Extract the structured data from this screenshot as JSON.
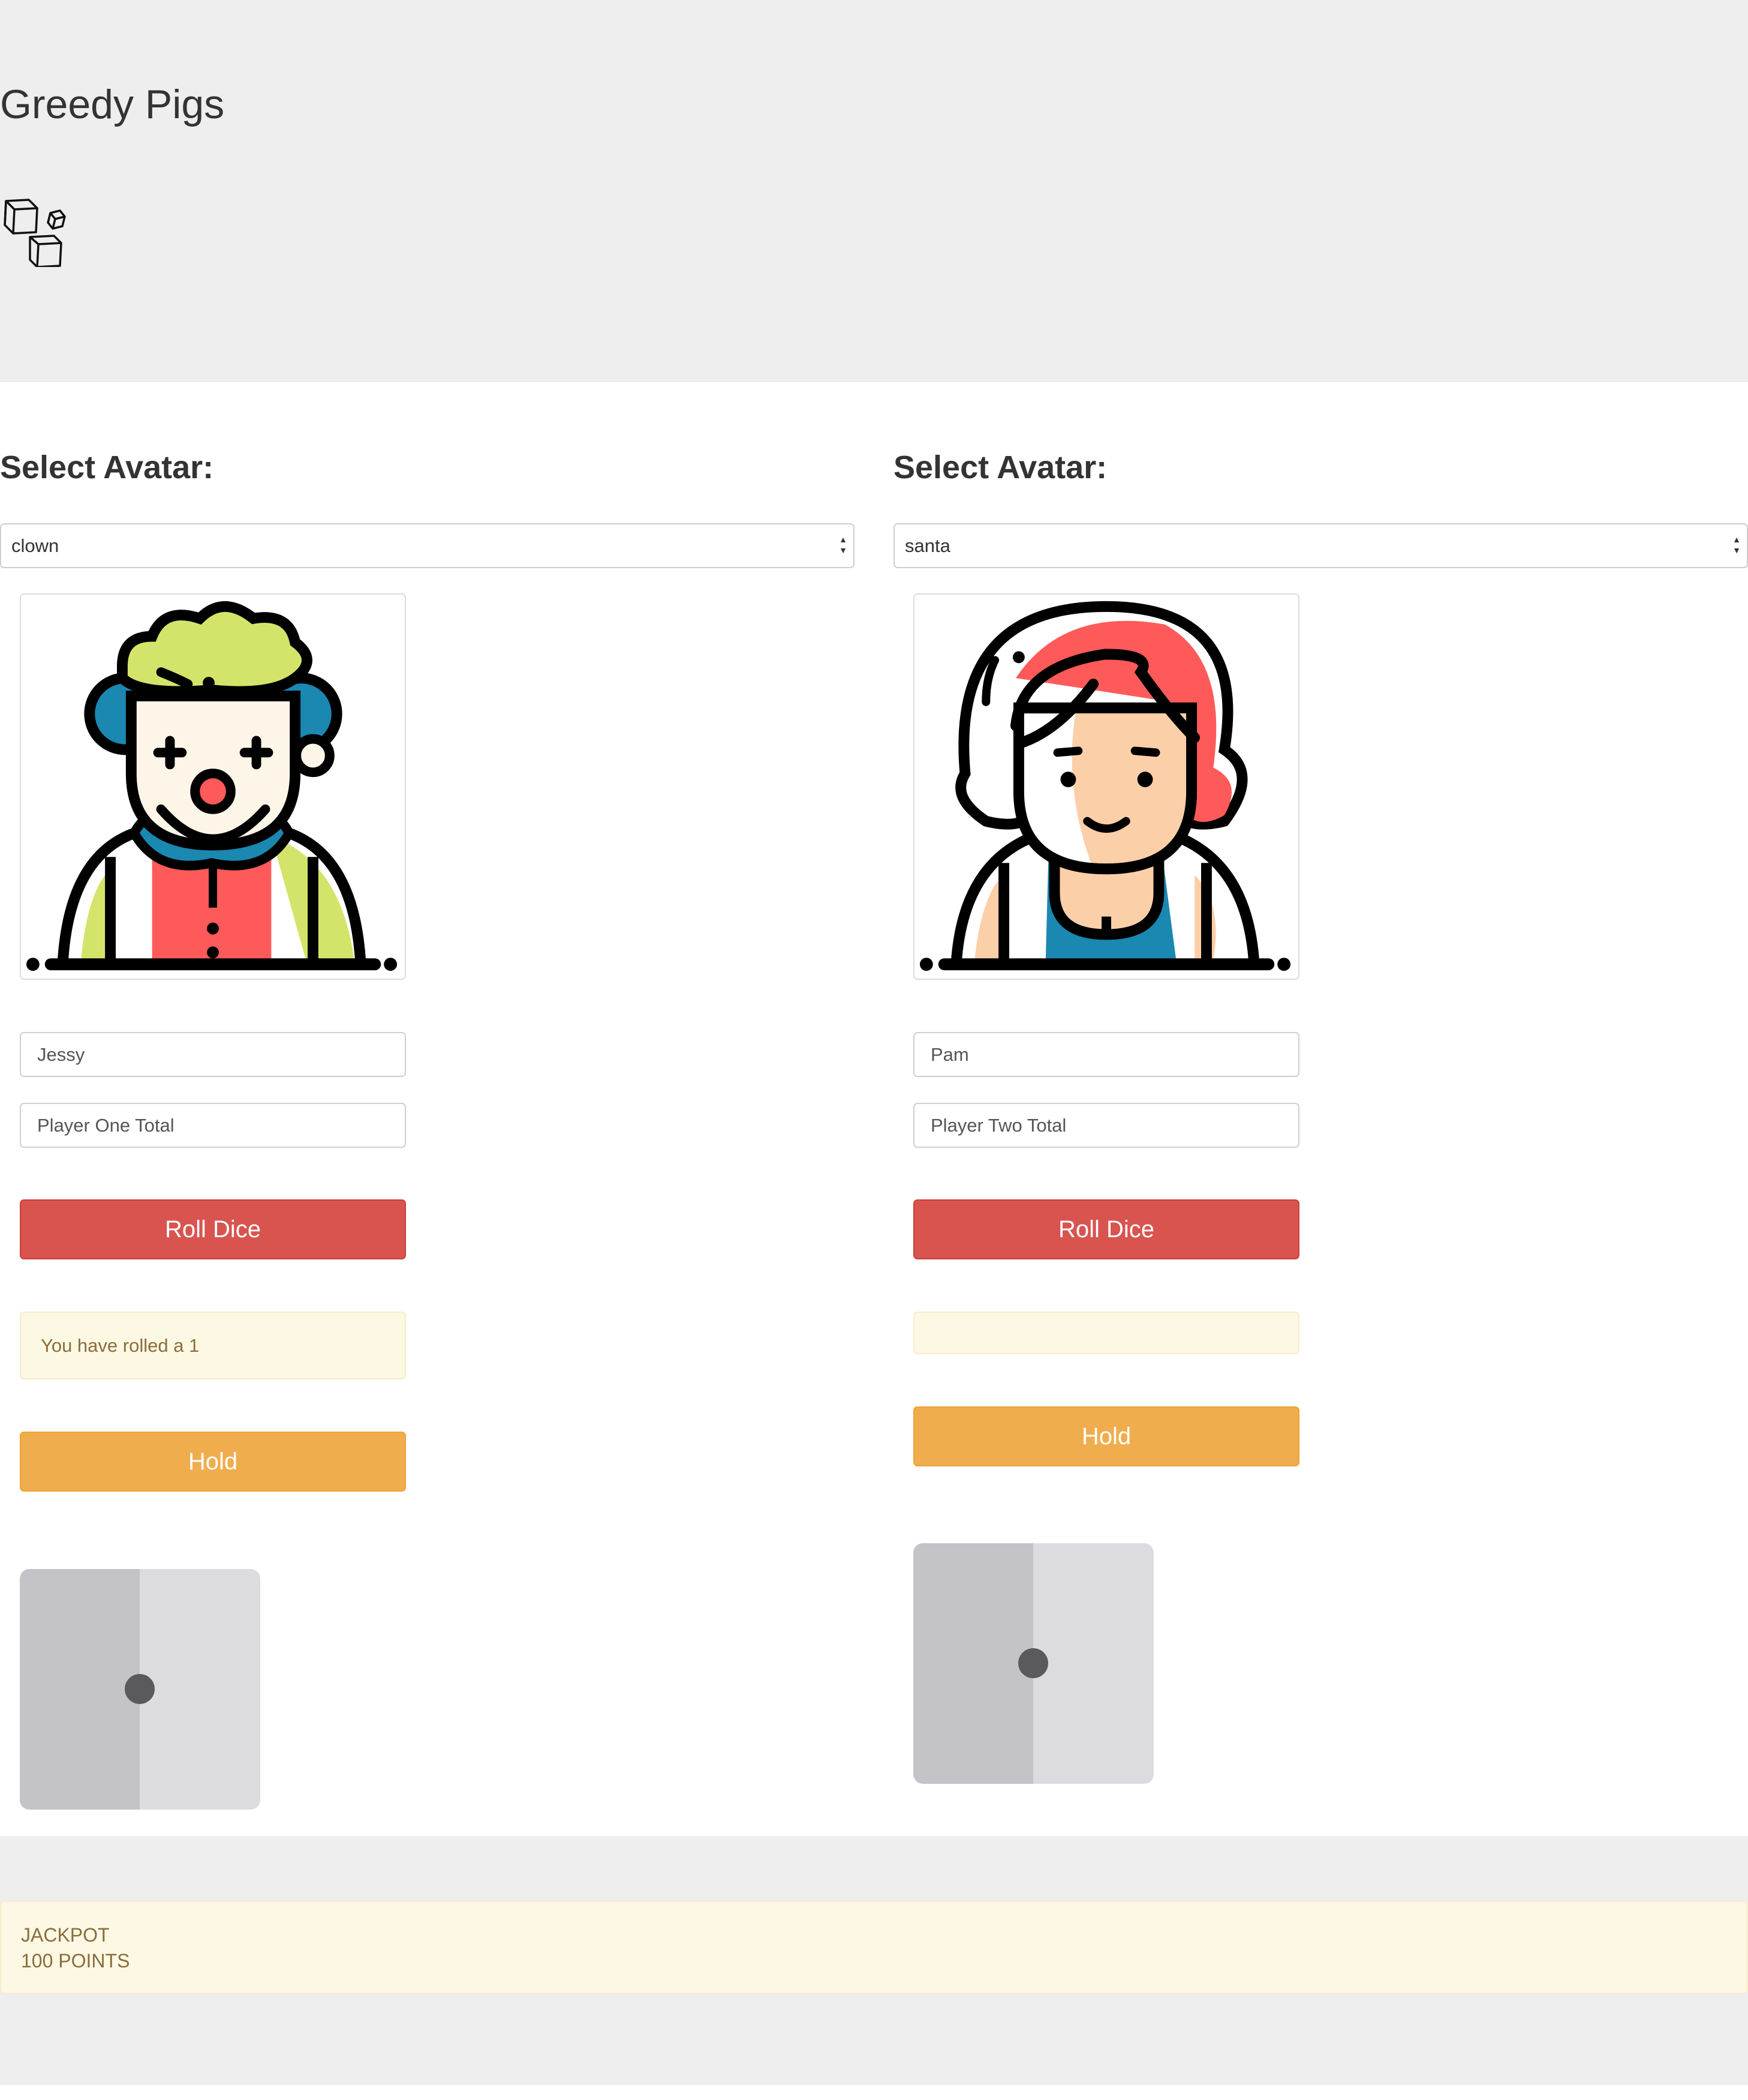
{
  "app": {
    "title": "Greedy Pigs"
  },
  "player_one": {
    "heading": "Select Avatar:",
    "avatar_selected": "clown",
    "name_value": "Jessy",
    "total_placeholder": "Player One Total",
    "roll_label": "Roll Dice",
    "message": "You have rolled a 1",
    "hold_label": "Hold",
    "die_value": 1
  },
  "player_two": {
    "heading": "Select Avatar:",
    "avatar_selected": "santa",
    "name_value": "Pam",
    "total_placeholder": "Player Two Total",
    "roll_label": "Roll Dice",
    "message": "",
    "hold_label": "Hold",
    "die_value": 1
  },
  "jackpot": {
    "label": "JACKPOT",
    "points": "100 POINTS"
  },
  "colors": {
    "roll_button": "#d9534f",
    "hold_button": "#f0ad4e",
    "alert_background": "#fcf8e3",
    "alert_text": "#8a6d3b",
    "header_background": "#eeeeee"
  },
  "icons": {
    "logo": "dice-icon",
    "avatar_one": "clown-avatar-icon",
    "avatar_two": "woman-avatar-icon",
    "die": "die-face-icon"
  }
}
